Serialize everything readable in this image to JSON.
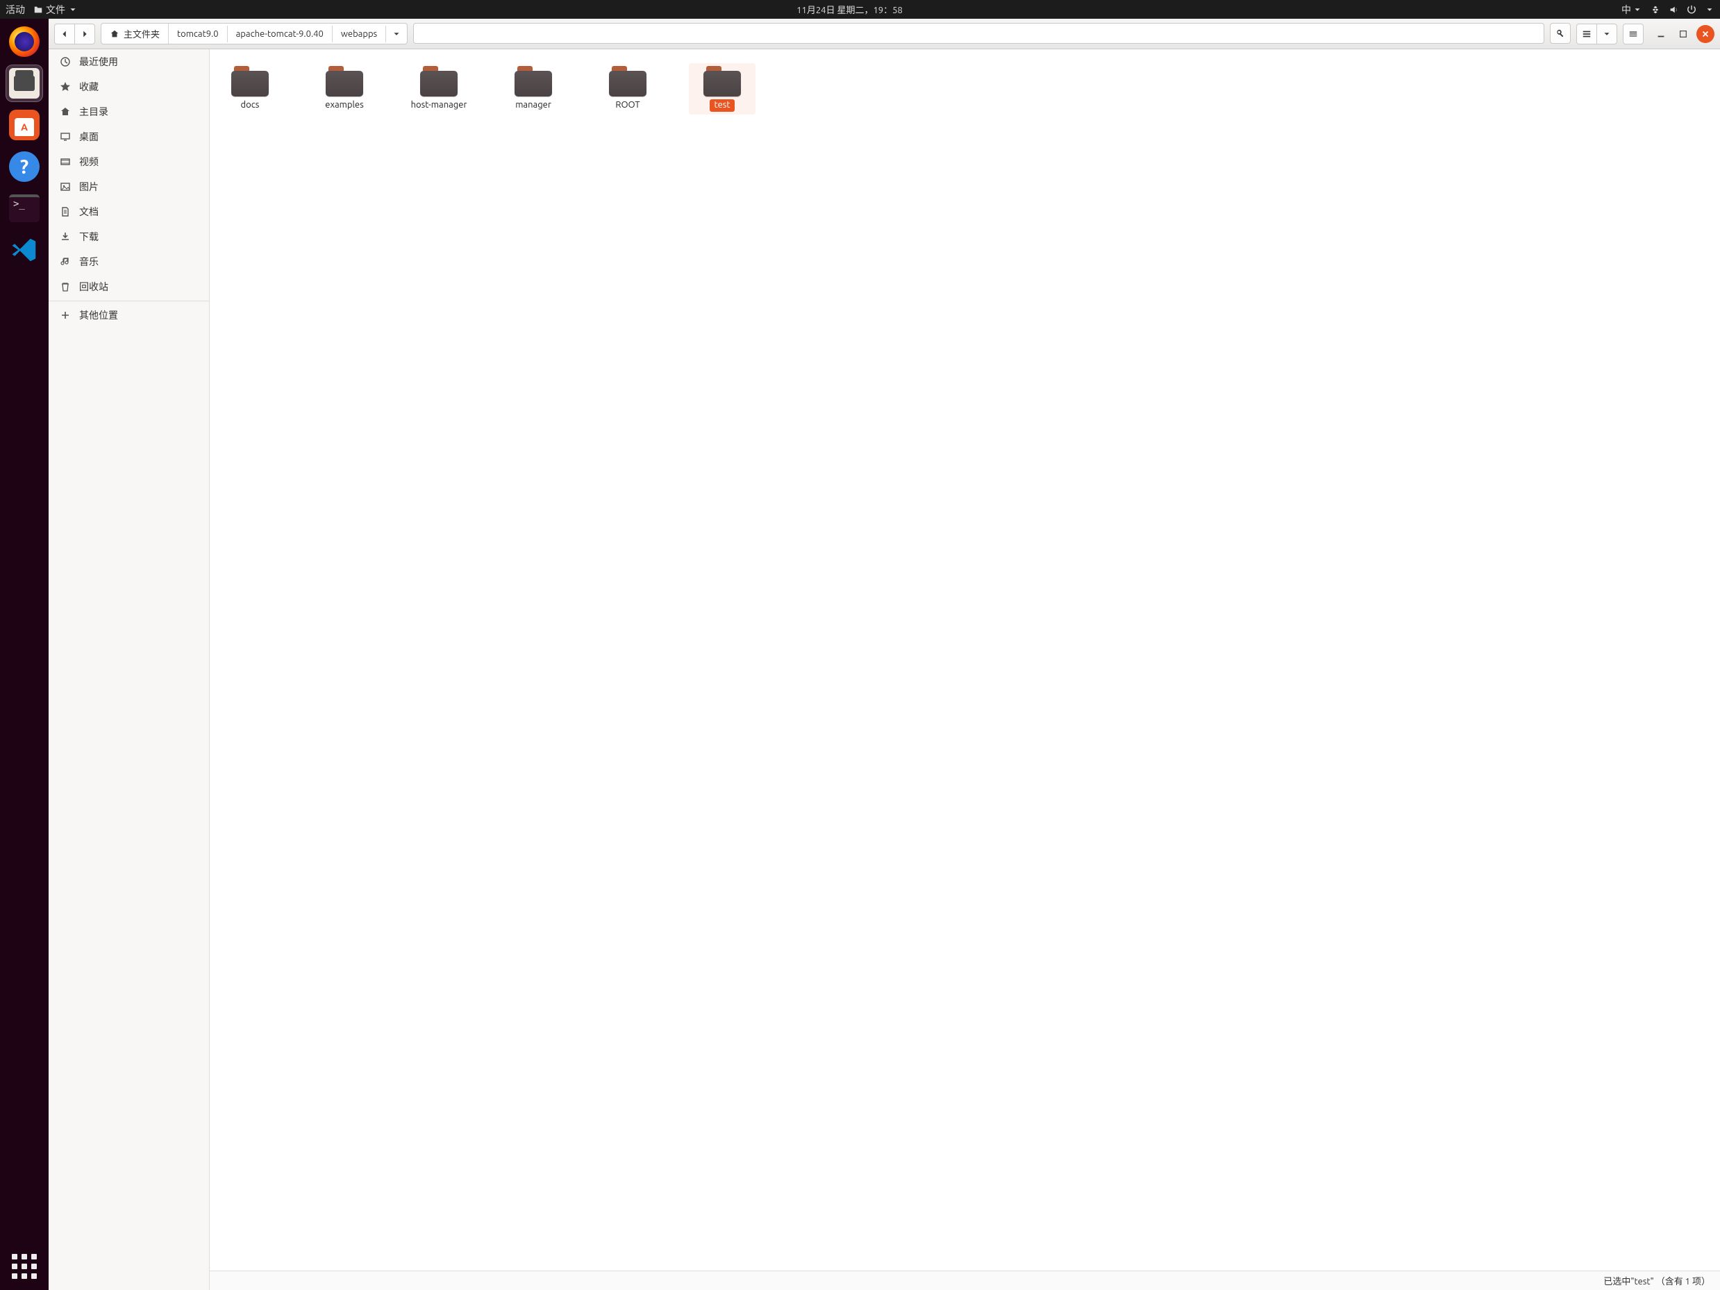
{
  "top_panel": {
    "activities": "活动",
    "app_menu": "文件",
    "clock": "11月24日 星期二，19：58",
    "ime": "中"
  },
  "dock": {
    "items": [
      "firefox",
      "files",
      "software",
      "help",
      "terminal",
      "vscode"
    ]
  },
  "headerbar": {
    "home_label": "主文件夹",
    "path": [
      "tomcat9.0",
      "apache-tomcat-9.0.40",
      "webapps"
    ]
  },
  "sidebar": {
    "items": [
      {
        "icon": "clock",
        "label": "最近使用"
      },
      {
        "icon": "star",
        "label": "收藏"
      },
      {
        "icon": "home",
        "label": "主目录"
      },
      {
        "icon": "desktop",
        "label": "桌面"
      },
      {
        "icon": "video",
        "label": "视频"
      },
      {
        "icon": "image",
        "label": "图片"
      },
      {
        "icon": "doc",
        "label": "文档"
      },
      {
        "icon": "download",
        "label": "下载"
      },
      {
        "icon": "music",
        "label": "音乐"
      },
      {
        "icon": "trash",
        "label": "回收站"
      }
    ],
    "other": "其他位置"
  },
  "files": [
    {
      "name": "docs",
      "selected": false
    },
    {
      "name": "examples",
      "selected": false
    },
    {
      "name": "host-manager",
      "selected": false
    },
    {
      "name": "manager",
      "selected": false
    },
    {
      "name": "ROOT",
      "selected": false
    },
    {
      "name": "test",
      "selected": true
    }
  ],
  "statusbar": {
    "text": "已选中\"test\"  （含有 1 项）"
  }
}
